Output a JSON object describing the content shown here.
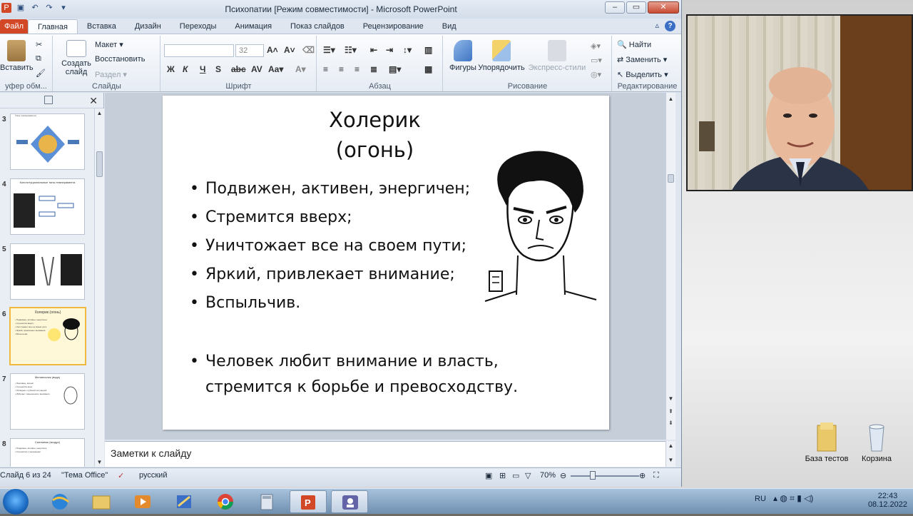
{
  "window": {
    "title": "Психопатии [Режим совместимости]  -  Microsoft PowerPoint"
  },
  "tabs": [
    "Файл",
    "Главная",
    "Вставка",
    "Дизайн",
    "Переходы",
    "Анимация",
    "Показ слайдов",
    "Рецензирование",
    "Вид"
  ],
  "ribbon": {
    "clipboard": {
      "paste": "Вставить",
      "label": "уфер обм..."
    },
    "slides": {
      "new_slide": "Создать слайд",
      "layout": "Макет",
      "reset": "Восстановить",
      "section": "Раздел",
      "label": "Слайды"
    },
    "font": {
      "size": "32",
      "label": "Шрифт"
    },
    "paragraph": {
      "label": "Абзац"
    },
    "drawing": {
      "shapes": "Фигуры",
      "arrange": "Упорядочить",
      "quick_styles": "Экспресс-стили",
      "label": "Рисование"
    },
    "editing": {
      "find": "Найти",
      "replace": "Заменить",
      "select": "Выделить",
      "label": "Редактирование"
    }
  },
  "thumbnails": [
    {
      "num": "3",
      "title": "Типы темпераментов"
    },
    {
      "num": "4",
      "title": "Конституциональные типы темперамента"
    },
    {
      "num": "5",
      "title": ""
    },
    {
      "num": "6",
      "title": "Холерик (огонь)",
      "selected": true
    },
    {
      "num": "7",
      "title": "Меланхолик (вода)"
    },
    {
      "num": "8",
      "title": "Сангвиник (воздух)"
    }
  ],
  "slide": {
    "title_line1": "Холерик",
    "title_line2": "(огонь)",
    "bullets": [
      "Подвижен, активен, энергичен;",
      "Стремится вверх;",
      "Уничтожает все на своем пути;",
      "Яркий, привлекает внимание;",
      "Вспыльчив."
    ],
    "summary": "Человек любит внимание и власть, стремится к борьбе и превосходству."
  },
  "notes": {
    "placeholder": "Заметки к слайду"
  },
  "statusbar": {
    "slide_info": "Слайд 6 из 24",
    "theme": "\"Тема Office\"",
    "language": "русский",
    "zoom": "70%"
  },
  "desktop": {
    "icon1": "База тестов",
    "icon2": "Корзина"
  },
  "tray": {
    "lang": "RU",
    "time": "22:43",
    "date": "08.12.2022"
  }
}
